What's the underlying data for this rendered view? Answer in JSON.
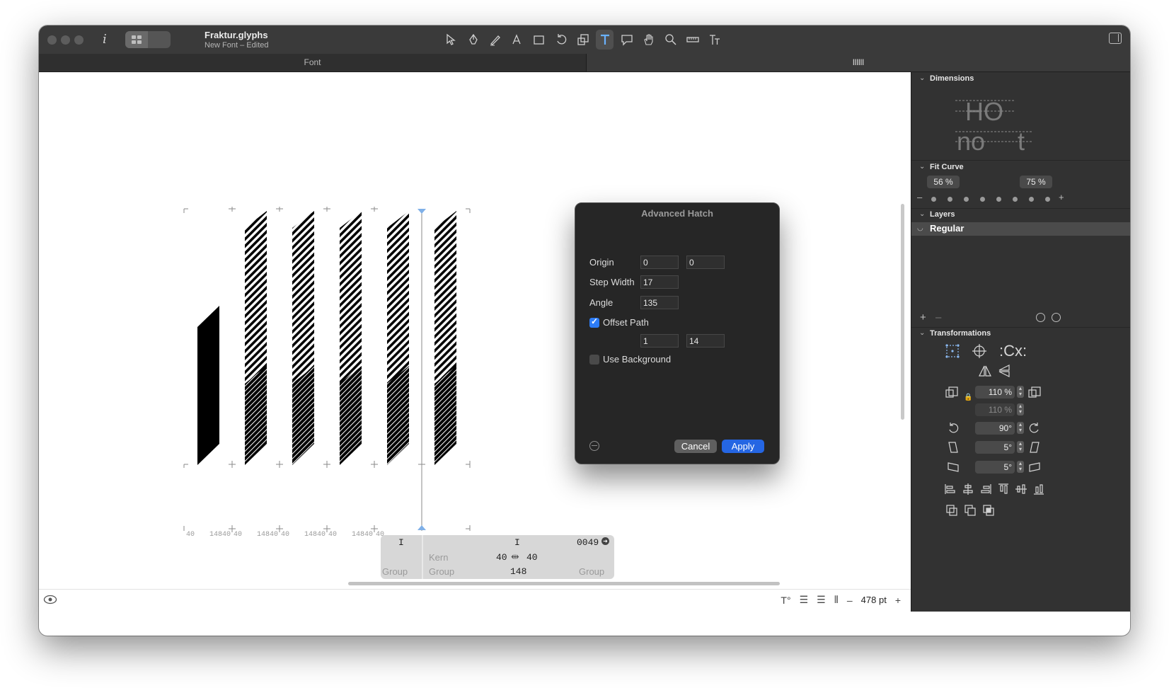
{
  "window": {
    "title": "Fraktur.glyphs",
    "subtitle": "New Font – Edited"
  },
  "tabs": [
    {
      "label": "Font"
    },
    {
      "label": "llllll"
    }
  ],
  "toolbar": {
    "tools": [
      "select-tool-icon",
      "pen-tool-icon",
      "draw-tool-icon",
      "primitives-tool-icon",
      "rectangle-tool-icon",
      "rotate-tool-icon",
      "scale-tool-icon",
      "text-tool-icon",
      "annotation-tool-icon",
      "hand-tool-icon",
      "zoom-tool-icon",
      "measure-tool-icon",
      "type-tool-icon"
    ],
    "active_tool": "text-tool-icon"
  },
  "canvas": {
    "metrics_labels": [
      "40",
      "14840",
      "40",
      "14840",
      "40",
      "14840",
      "40",
      "14840",
      "40"
    ],
    "glyph_count": 6
  },
  "info_strip": {
    "left_glyph": "I",
    "center_glyph": "I",
    "unicode": "0049",
    "kern_label": "Kern",
    "lsb": "40",
    "rsb": "40",
    "width": "148",
    "group_left": "Group",
    "group_center": "Group",
    "group_right": "Group"
  },
  "bottombar": {
    "size": "478 pt",
    "minus": "–",
    "plus": "+"
  },
  "dialog": {
    "title": "Advanced Hatch",
    "origin_label": "Origin",
    "origin_x": "0",
    "origin_y": "0",
    "step_width_label": "Step Width",
    "step_width": "17",
    "angle_label": "Angle",
    "angle": "135",
    "offset_path_label": "Offset Path",
    "offset_path_checked": true,
    "offset_a": "1",
    "offset_b": "14",
    "use_background_label": "Use Background",
    "use_background_checked": false,
    "cancel_label": "Cancel",
    "apply_label": "Apply"
  },
  "panel": {
    "dimensions_title": "Dimensions",
    "fit_curve_title": "Fit Curve",
    "fit_curve_min": "56 %",
    "fit_curve_max": "75 %",
    "layers_title": "Layers",
    "layer_name": "Regular",
    "transformations_title": "Transformations",
    "scale_x": "110 %",
    "scale_y": "110 %",
    "rotate": "90°",
    "slant_x": "5°",
    "slant_y": "5°"
  },
  "colors": {
    "accent": "#2566e3",
    "active_tool": "#6ab2ff",
    "panel_bg": "#323232",
    "dialog_bg": "#262626"
  }
}
